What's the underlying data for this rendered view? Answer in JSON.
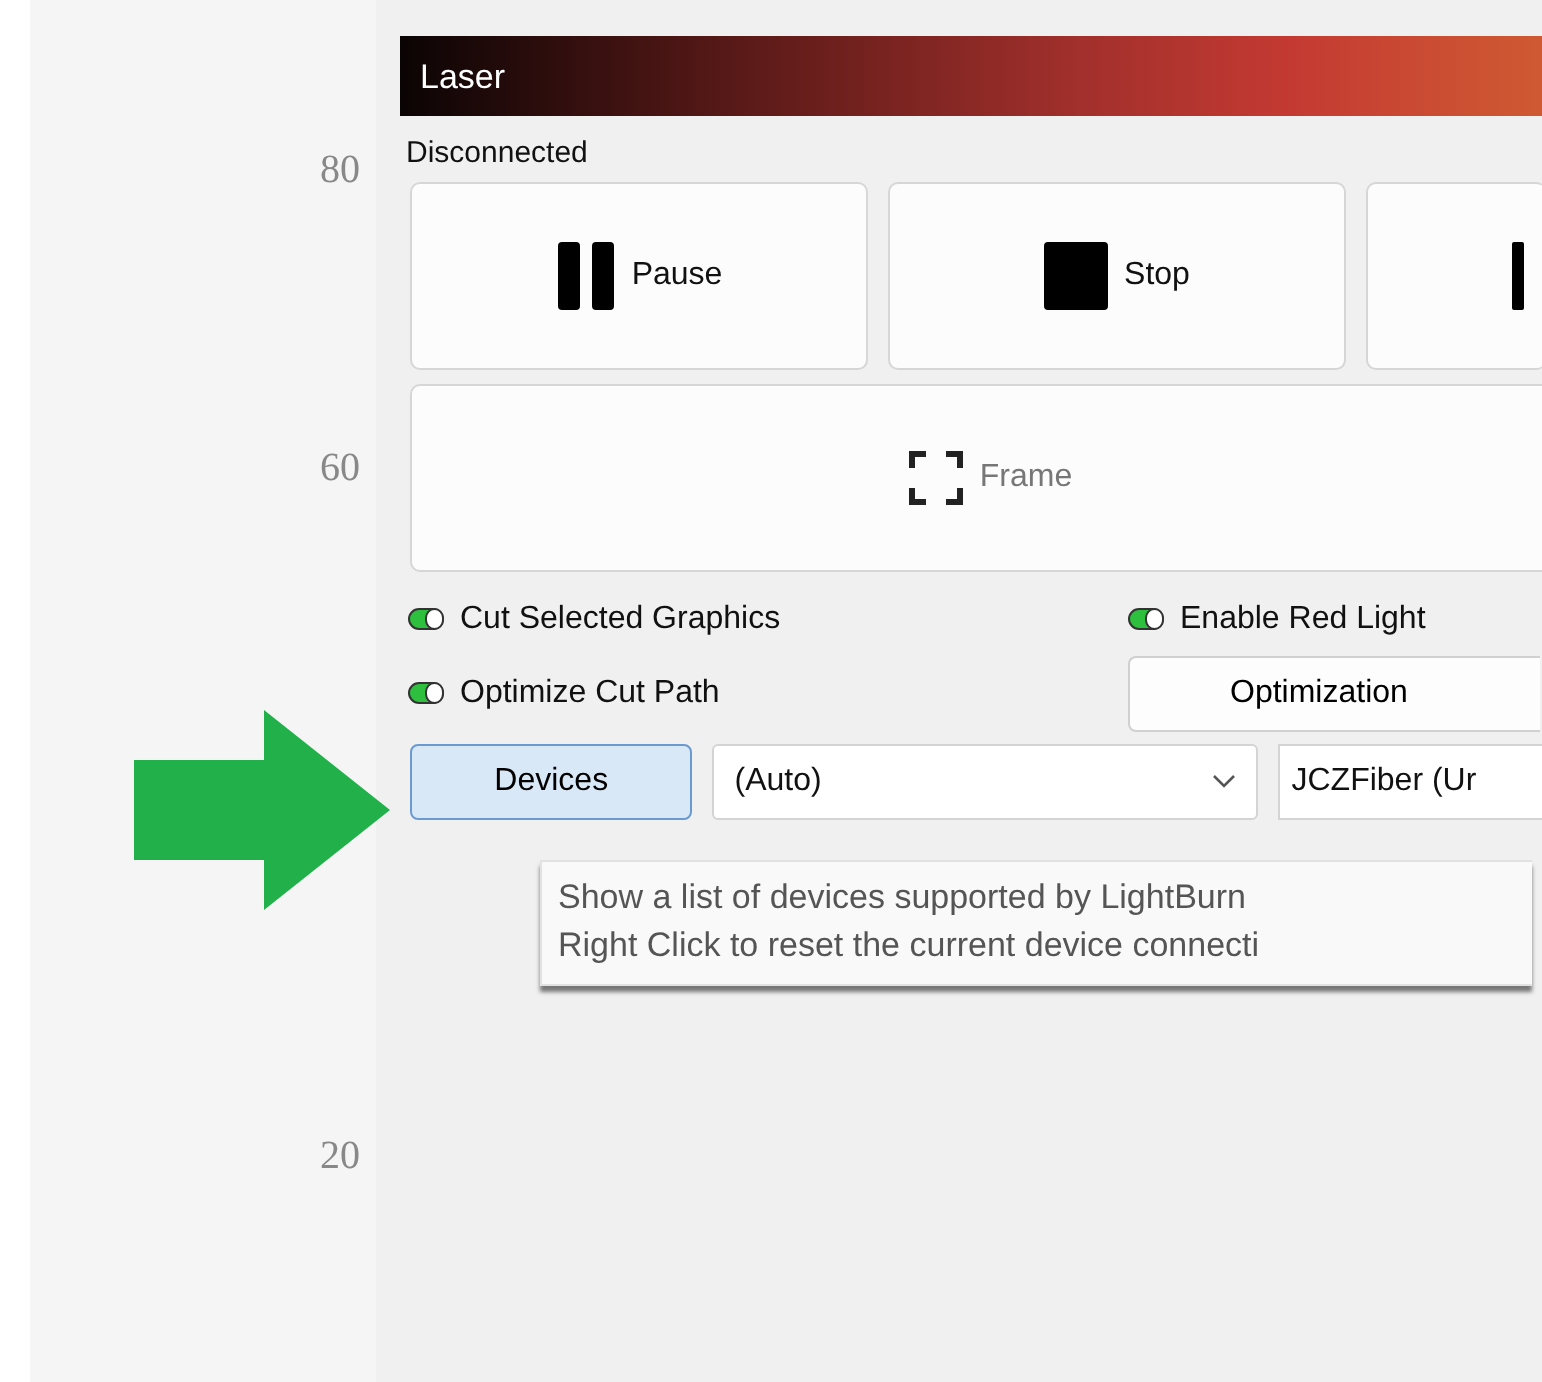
{
  "ruler": {
    "labels": [
      "80",
      "60",
      "20"
    ]
  },
  "panel": {
    "title": "Laser",
    "status": "Disconnected",
    "buttons": [
      {
        "kind": "pause",
        "label": "Pause"
      },
      {
        "kind": "stop",
        "label": "Stop"
      },
      {
        "kind": "cut"
      }
    ],
    "frame_button": {
      "label": "Frame"
    },
    "options": [
      {
        "label": "Cut Selected Graphics",
        "on": true
      },
      {
        "label": "Enable Red Light",
        "on": true
      },
      {
        "label": "Optimize Cut Path",
        "on": true
      }
    ],
    "optimization_button": {
      "label": "Optimization"
    },
    "devices_button": {
      "label": "Devices"
    },
    "port_select": {
      "value": "(Auto)"
    },
    "device_field": {
      "value": "JCZFiber (Ur"
    },
    "tooltip": {
      "lines": [
        "Show a list of devices supported by LightBurn",
        "Right Click to reset the current device connecti"
      ]
    }
  }
}
